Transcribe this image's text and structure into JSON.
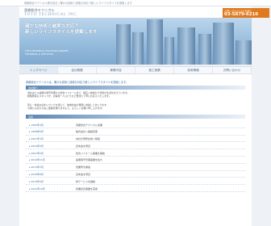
{
  "topbar": {
    "text": "東都総合テクニカル株式会社 | 確かな技術と誠実な対応で新しいライフスタイルを提案します"
  },
  "header": {
    "logo_jp": "東都総合テクニカル",
    "logo_en": "TOTO TECHNICAL INC.",
    "contact_label": "お問い合わせはお気軽に",
    "contact_tel": "03-5879-6210"
  },
  "hero": {
    "line1": "確かな技術と誠実な対応で",
    "line2": "新しいライフスタイルを提案します",
    "sub1": "TOTO TECHNICAL SOLUTION CONCEPT",
    "sub2": "TECHNICAL & LIFE STYLE"
  },
  "nav": {
    "items": [
      {
        "label": "トップページ"
      },
      {
        "label": "会社概要"
      },
      {
        "label": "事業内容"
      },
      {
        "label": "施工実績"
      },
      {
        "label": "採用情報"
      },
      {
        "label": "お問い合わせ"
      }
    ]
  },
  "main": {
    "breadcrumb": "東都総合テクニカルは、確かな技術と誠実な対応で新しいライフスタイルを提案します。",
    "section1_title": "会社紹介",
    "para1": [
      "当社はビル設備の保守管理から総合リフォームまで、幅広い技術力で皆様の生活を支えています。",
      "経験豊富なスタッフが、お客様一人ひとりのご要望に丁寧にお応えいたします。"
    ],
    "para2": [
      "安心・快適な住まいづくりを通じて、地域社会の発展に貢献してまいります。",
      "今後とも変わらぬご愛顧を賜りますよう、よろしくお願い申し上げます。"
    ],
    "section2_title": "沿革",
    "history": [
      {
        "date": "1995年4月",
        "text": "東都総合テクニカル創業"
      },
      {
        "date": "1998年6月",
        "text": "株式会社へ組織変更"
      },
      {
        "date": "2001年3月",
        "text": "本社を現所在地へ移転"
      },
      {
        "date": "2004年9月",
        "text": "資本金を増資"
      },
      {
        "date": "2007年5月",
        "text": "総合リフォーム事業を開始"
      },
      {
        "date": "2010年11月",
        "text": "設備保守管理事業を拡大"
      },
      {
        "date": "2013年2月",
        "text": "営業所を開設"
      },
      {
        "date": "2016年8月",
        "text": "資本金を増資"
      },
      {
        "date": "2019年4月",
        "text": "新サービスを開始"
      },
      {
        "date": "2022年10月",
        "text": "創業記念事業を実施"
      }
    ]
  }
}
